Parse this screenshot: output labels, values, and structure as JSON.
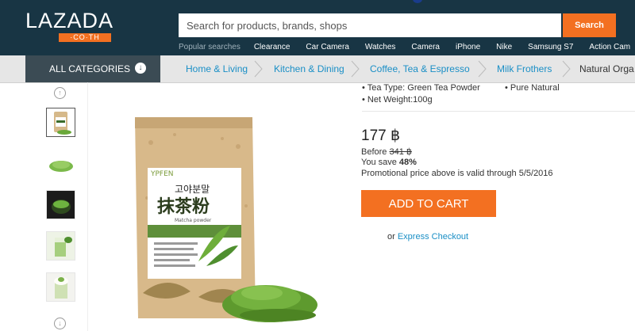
{
  "header": {
    "logo_text": "LAZADA",
    "logo_domain": "·CO·TH",
    "search_placeholder": "Search for products, brands, shops",
    "search_button": "Search",
    "popular_label": "Popular searches",
    "popular_tags": [
      "Clearance",
      "Car Camera",
      "Watches",
      "Camera",
      "iPhone",
      "Nike",
      "Samsung S7",
      "Action Cam"
    ]
  },
  "nav": {
    "all_categories": "ALL CATEGORIES",
    "breadcrumbs": [
      "Home & Living",
      "Kitchen & Dining",
      "Coffee, Tea & Espresso",
      "Milk Frothers",
      "Natural Orga"
    ]
  },
  "product": {
    "specs": {
      "tea_type": "• Tea Type: Green Tea Powder",
      "pure": "• Pure Natural",
      "net_weight": "• Net Weight:100g"
    },
    "price": "177 ฿",
    "before_label": "Before",
    "before_price": "341 ฿",
    "save_label": "You save",
    "save_pct": "48%",
    "promo_note": "Promotional price above is valid through 5/5/2016",
    "add_to_cart": "ADD TO CART",
    "express_prefix": "or",
    "express_link": "Express Checkout"
  },
  "package": {
    "brand": "YPFEN",
    "korean": "고야분말",
    "chinese": "抹茶粉",
    "sub": "Matcha powder"
  },
  "colors": {
    "header_bg": "#183544",
    "accent": "#f37021",
    "link": "#1a8fc6"
  },
  "icons": {
    "up": "arrow-up-icon",
    "down": "arrow-down-icon",
    "categories": "arrow-down-circle-icon"
  }
}
